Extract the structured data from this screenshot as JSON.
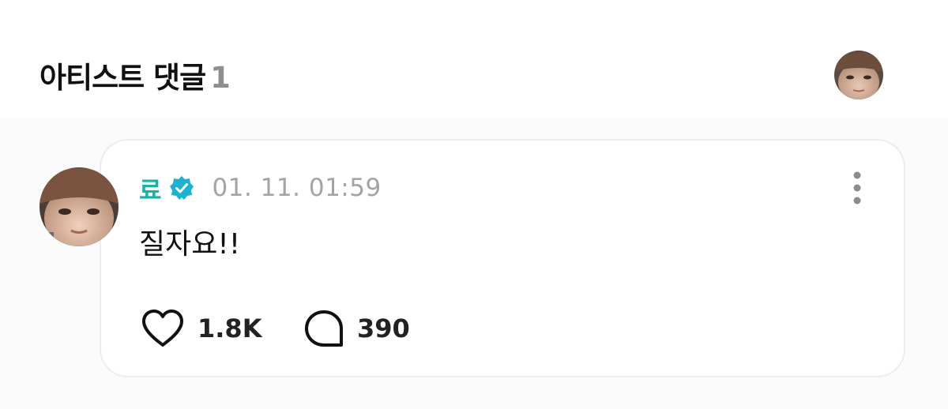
{
  "header": {
    "title": "아티스트 댓글",
    "count": "1",
    "profile_avatar_icon": "artist-avatar"
  },
  "comment": {
    "author": "료",
    "verified_icon": "verified-badge-icon",
    "timestamp": "01. 11. 01:59",
    "text": "질자요!!",
    "more_icon": "more-vertical-icon",
    "likes": {
      "icon": "heart-icon",
      "count": "1.8K"
    },
    "replies": {
      "icon": "comment-bubble-icon",
      "count": "390"
    }
  },
  "colors": {
    "author": "#17b3a3",
    "verified": "#1db2cf",
    "timestamp": "#a3a3a8",
    "card_border": "#ececf1"
  }
}
